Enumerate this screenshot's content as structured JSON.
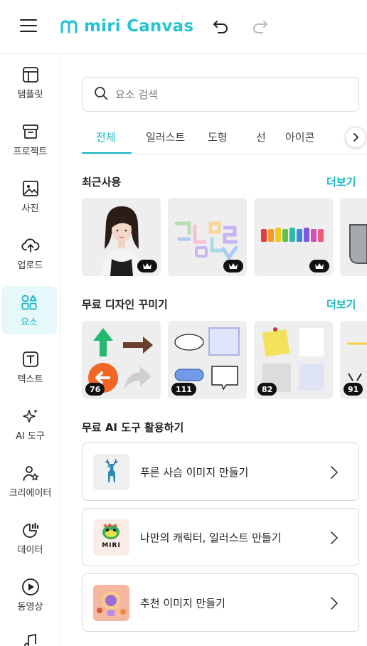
{
  "header": {
    "logo_text": "miri Canvas",
    "menu_icon": "hamburger-icon",
    "undo_icon": "undo-icon",
    "redo_icon": "redo-icon"
  },
  "sidebar": {
    "items": [
      {
        "label": "템플릿",
        "icon": "template-icon"
      },
      {
        "label": "프로젝트",
        "icon": "archive-icon"
      },
      {
        "label": "사진",
        "icon": "image-icon"
      },
      {
        "label": "업로드",
        "icon": "cloud-upload-icon"
      },
      {
        "label": "요소",
        "icon": "shapes-icon",
        "active": true
      },
      {
        "label": "텍스트",
        "icon": "text-t-icon"
      },
      {
        "label": "AI 도구",
        "icon": "sparkle-icon"
      },
      {
        "label": "크리에이터",
        "icon": "creator-icon"
      },
      {
        "label": "데이터",
        "icon": "chart-icon"
      },
      {
        "label": "동영상",
        "icon": "play-icon"
      },
      {
        "label": "",
        "icon": "music-icon"
      }
    ]
  },
  "search": {
    "placeholder": "요소 검색"
  },
  "tabs": [
    "전체",
    "일러스트",
    "도형",
    "선",
    "아이콘"
  ],
  "sections": {
    "recent": {
      "title": "최근사용",
      "more": "더보기"
    },
    "free_design": {
      "title": "무료 디자인 꾸미기",
      "more": "더보기",
      "counts": [
        "76",
        "111",
        "82",
        "91"
      ]
    },
    "ai_tools": {
      "title": "무료 AI 도구 활용하기",
      "items": [
        {
          "label": "푸른 사슴 이미지 만들기"
        },
        {
          "label": "나만의 캐릭터, 일러스트 만들기",
          "thumb_text": "MIRI"
        },
        {
          "label": "추천 이미지 만들기"
        }
      ]
    }
  },
  "colors": {
    "accent": "#13b6c2",
    "logo": "#23c4cf",
    "active_bg": "#e6f8fa"
  }
}
